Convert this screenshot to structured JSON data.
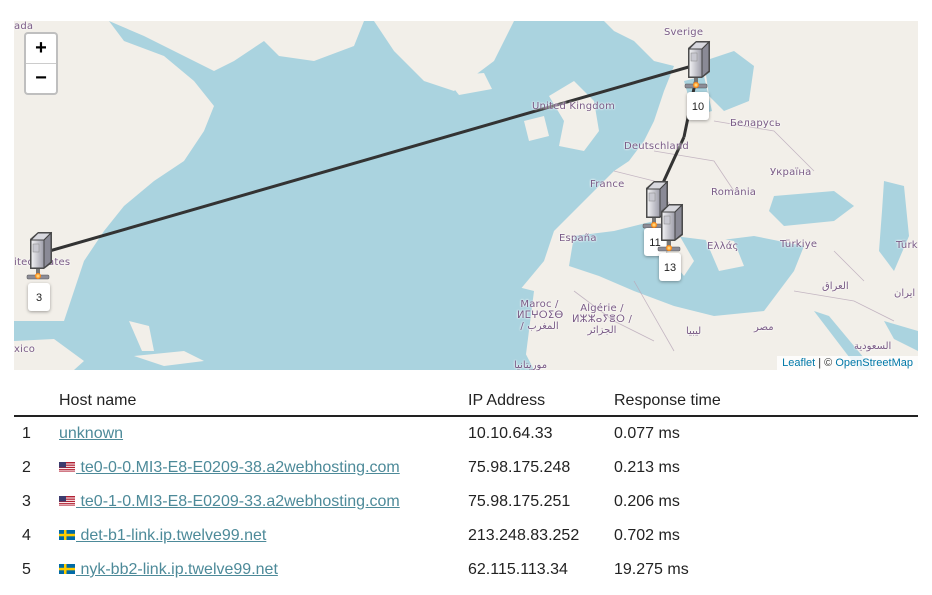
{
  "map": {
    "zoom_in_label": "+",
    "zoom_out_label": "−",
    "attribution": {
      "leaflet": "Leaflet",
      "separator": " | © ",
      "osm": "OpenStreetMap"
    },
    "place_labels": [
      "ada",
      "Sverige",
      "United Kingdom",
      "Беларусь",
      "Deutschland",
      "Україна",
      "France",
      "România",
      "España",
      "Ελλάς",
      "Türkiye",
      "Türk",
      "ited States",
      "العراق",
      "ایران",
      "Maroc / ⵍⵎⵖⵔⵉⴱ / المغرب",
      "Algérie / ⵍⵣⵣⴰⵢⴻⵔ / الجزائر",
      "ليبيا",
      "مصر",
      "السعودية",
      "موريتانيا",
      "xico"
    ],
    "hop_markers": [
      {
        "label": "3"
      },
      {
        "label": "10"
      },
      {
        "label": "11"
      },
      {
        "label": "13"
      }
    ],
    "route_color": "#333333"
  },
  "table": {
    "headers": {
      "num": "",
      "host": "Host name",
      "ip": "IP Address",
      "time": "Response time"
    },
    "rows": [
      {
        "num": "1",
        "flag": "",
        "host": "unknown",
        "ip": "10.10.64.33",
        "time": "0.077 ms"
      },
      {
        "num": "2",
        "flag": "us-flag",
        "host": " te0-0-0.MI3-E8-E0209-38.a2webhosting.com",
        "ip": "75.98.175.248",
        "time": "0.213 ms"
      },
      {
        "num": "3",
        "flag": "us-flag",
        "host": " te0-1-0.MI3-E8-E0209-33.a2webhosting.com",
        "ip": "75.98.175.251",
        "time": "0.206 ms"
      },
      {
        "num": "4",
        "flag": "se-flag",
        "host": " det-b1-link.ip.twelve99.net",
        "ip": "213.248.83.252",
        "time": "0.702 ms"
      },
      {
        "num": "5",
        "flag": "se-flag",
        "host": " nyk-bb2-link.ip.twelve99.net",
        "ip": "62.115.113.34",
        "time": "19.275 ms"
      }
    ],
    "link_color": "#4d8a99"
  }
}
